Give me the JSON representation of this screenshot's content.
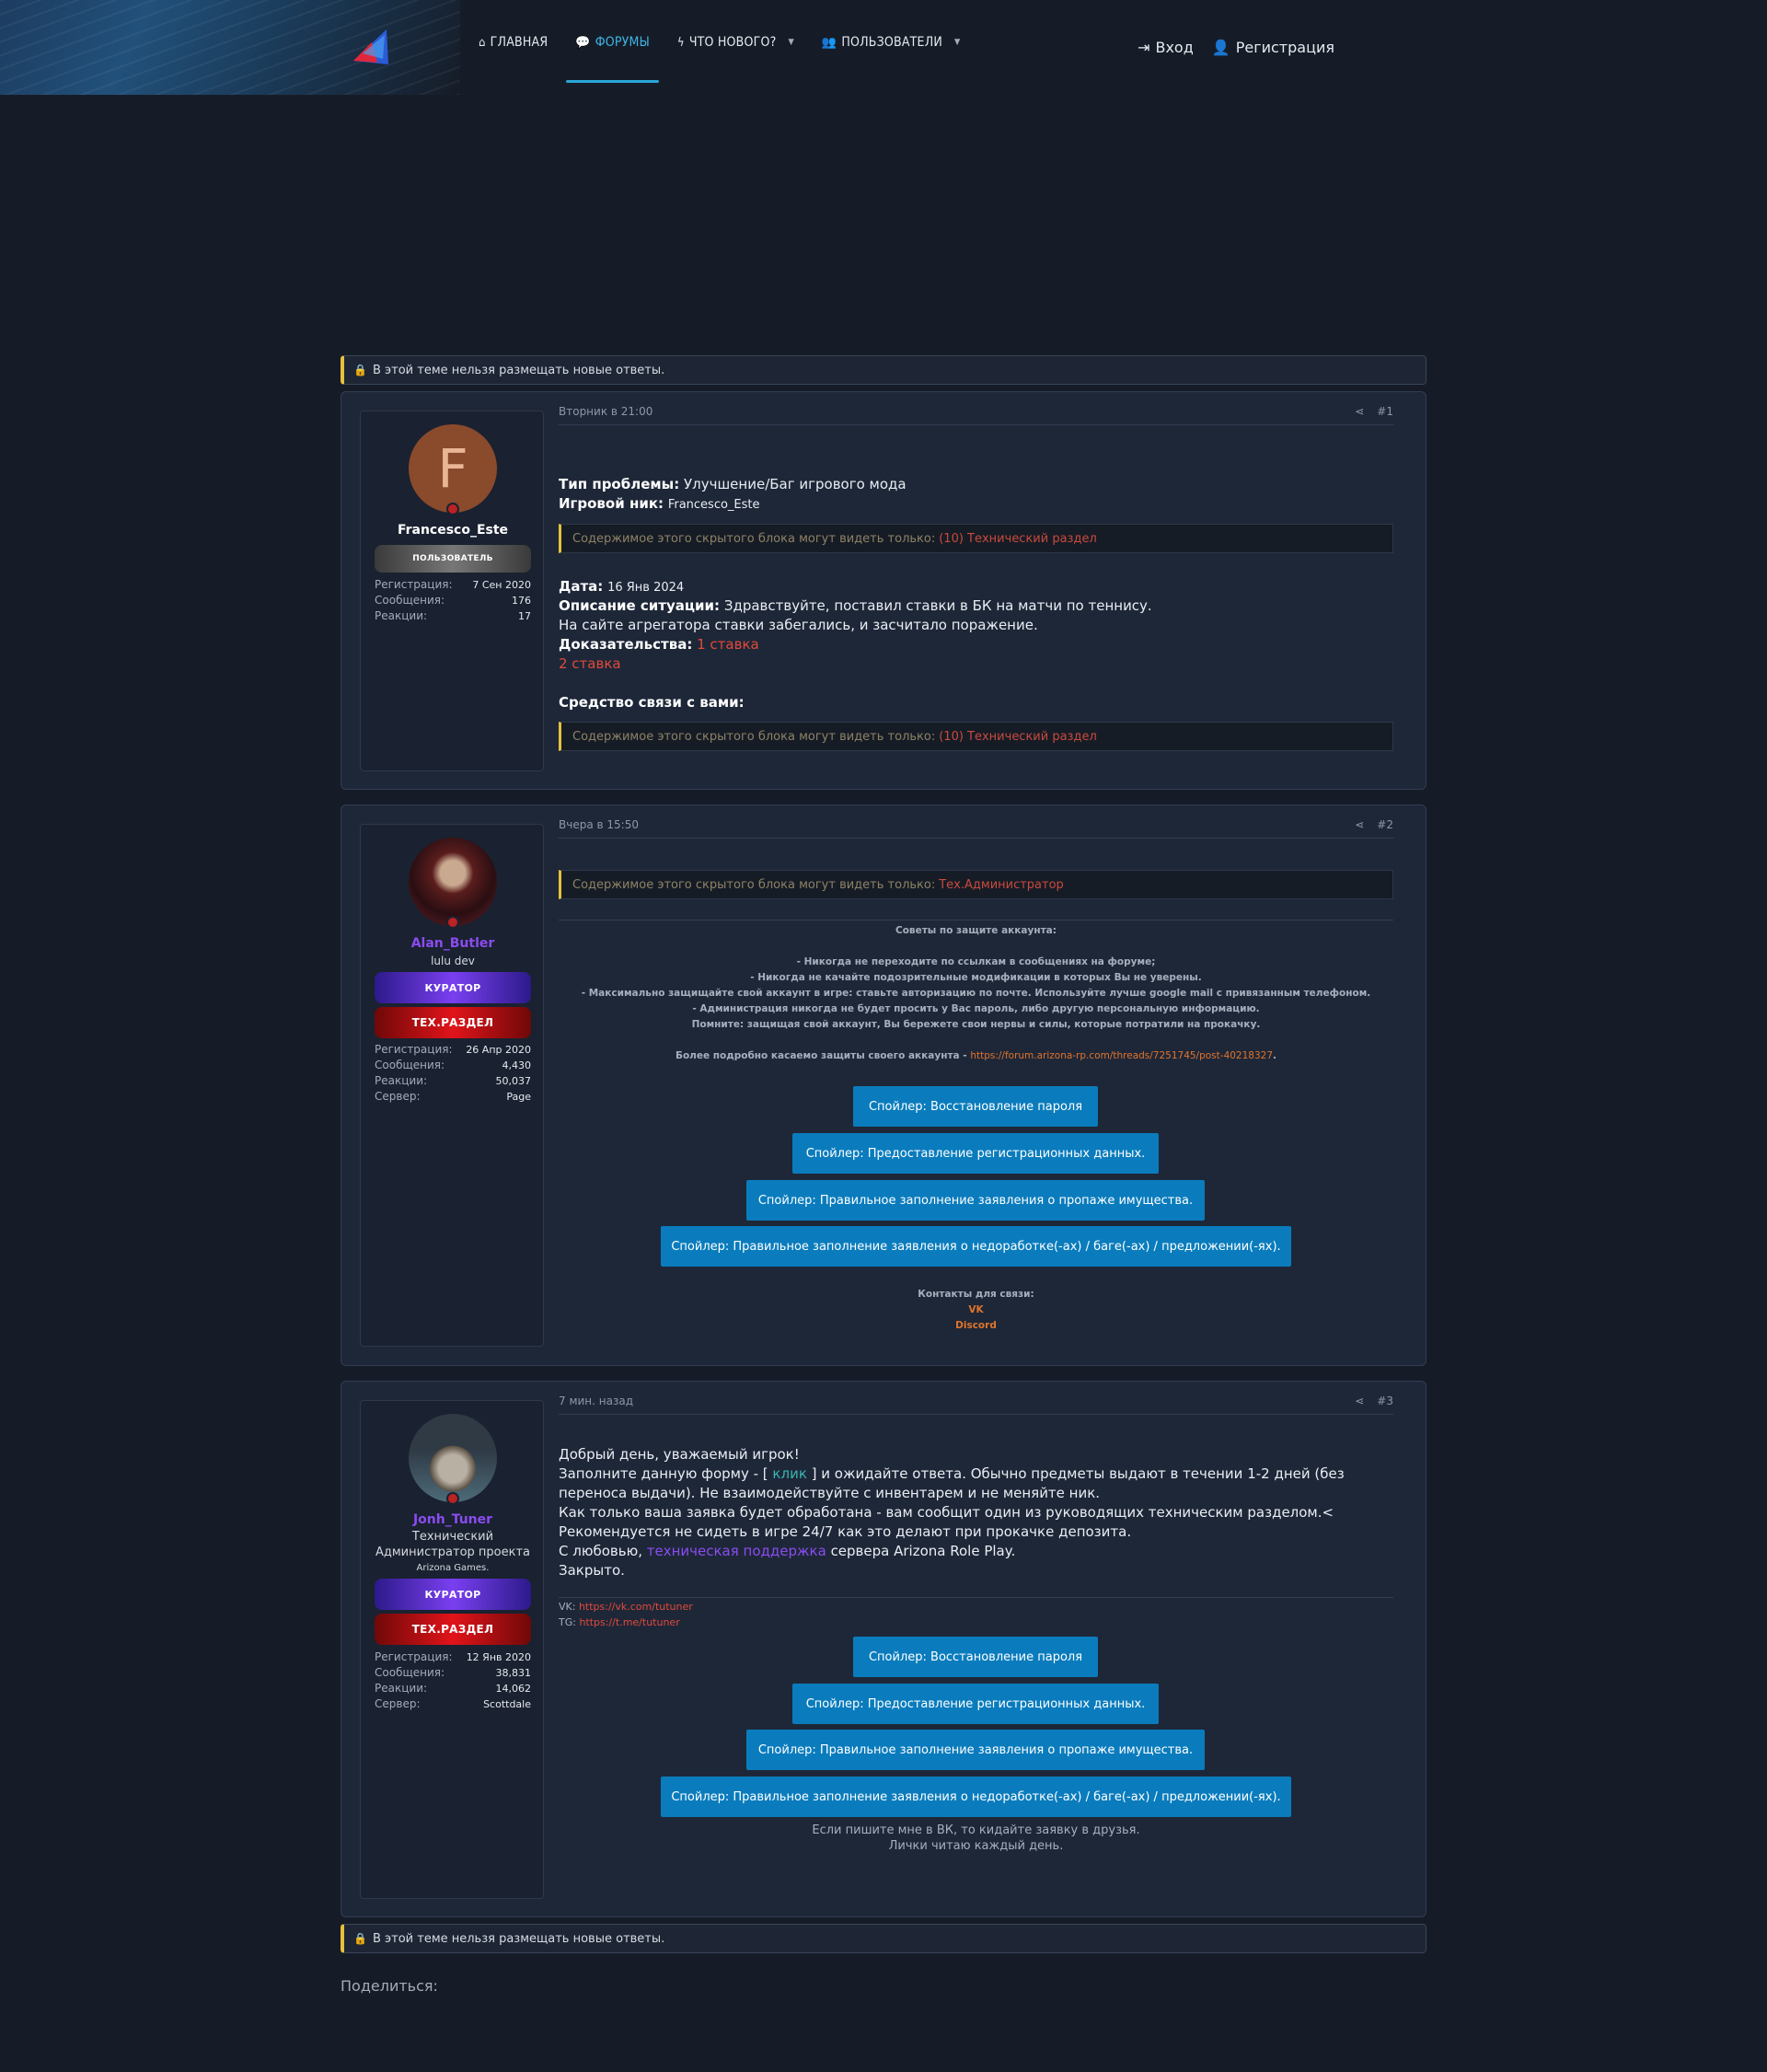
{
  "nav": {
    "home": "ГЛАВНАЯ",
    "forums": "ФОРУМЫ",
    "whats_new": "ЧТО НОВОГО?",
    "users": "ПОЛЬЗОВАТЕЛИ",
    "login": "Вход",
    "register": "Регистрация"
  },
  "notice": {
    "closed": "В этой теме нельзя размещать новые ответы."
  },
  "share_label": "Поделиться:",
  "hidden_prefix": "Содержимое этого скрытого блока могут видеть только:",
  "posts": [
    {
      "date": "Вторник в 21:00",
      "number": "#1",
      "user": {
        "letter": "F",
        "name": "Francesco_Este",
        "banner": "ПОЛЬЗОВАТЕЛЬ",
        "stats": [
          {
            "k": "Регистрация:",
            "v": "7 Сен 2020"
          },
          {
            "k": "Сообщения:",
            "v": "176"
          },
          {
            "k": "Реакции:",
            "v": "17"
          }
        ]
      },
      "problem_label": "Тип проблемы:",
      "problem_value": "Улучшение/Баг игрового мода",
      "nick_label": "Игровой ник:",
      "nick_value": "Francesco_Este",
      "hidden_who": "(10) Технический раздел",
      "date_label": "Дата:",
      "date_value": "16 Янв 2024",
      "desc_label": "Описание ситуации:",
      "desc_value": "Здравствуйте, поставил ставки в БК на матчи по теннису.",
      "desc_line2": "На сайте агрегатора ставки забегались, и засчитало поражение.",
      "proof_label": "Доказательства:",
      "proof_link1": "1 ставка",
      "proof_link2": "2 ставка",
      "contact_label": "Средство связи с вами:"
    },
    {
      "date": "Вчера в 15:50",
      "number": "#2",
      "user": {
        "name": "Alan_Butler",
        "title": "lulu dev",
        "banner1": "КУРАТОР",
        "banner2": "ТЕХ.РАЗДЕЛ",
        "stats": [
          {
            "k": "Регистрация:",
            "v": "26 Апр 2020"
          },
          {
            "k": "Сообщения:",
            "v": "4,430"
          },
          {
            "k": "Реакции:",
            "v": "50,037"
          },
          {
            "k": "Сервер:",
            "v": "Page"
          }
        ]
      },
      "hidden_who": "Тех.Администратор",
      "tips_title": "Советы по защите аккаунта:",
      "tips": [
        "- Никогда не переходите по ссылкам в сообщениях на форуме;",
        "- Никогда не качайте подозрительные модификации в которых Вы не уверены.",
        "- Максимально защищайте свой аккаунт в игре: ставьте авторизацию по почте. Используйте лучше google mail с привязанным телефоном.",
        "- Администрация никогда не будет просить у Вас пароль, либо другую персональную информацию.",
        "Помните: защищая свой аккаунт, Вы бережете свои нервы и силы, которые потратили на прокачку."
      ],
      "more_text": "Более подробно касаемо защиты своего аккаунта -",
      "more_link": "https://forum.arizona-rp.com/threads/7251745/post-40218327",
      "contacts_title": "Контакты для связи:",
      "contact1": "VK",
      "contact2": "Discord"
    },
    {
      "date": "7 мин. назад",
      "number": "#3",
      "user": {
        "name": "Jonh_Tuner",
        "title1": "Технический",
        "title2": "Администратор проекта",
        "title3": "Arizona Games.",
        "banner1": "КУРАТОР",
        "banner2": "ТЕХ.РАЗДЕЛ",
        "stats": [
          {
            "k": "Регистрация:",
            "v": "12 Янв 2020"
          },
          {
            "k": "Сообщения:",
            "v": "38,831"
          },
          {
            "k": "Реакции:",
            "v": "14,062"
          },
          {
            "k": "Сервер:",
            "v": "Scottdale"
          }
        ]
      },
      "l1": "Добрый день, уважаемый игрок!",
      "l2a": "Заполните данную форму - [",
      "l2link": "клик",
      "l2b": "] и ожидайте ответа. Обычно предметы выдают в течении 1-2 дней (без",
      "l3": "переноса выдачи). Не взаимодействуйте с инвентарем и не меняйте ник.",
      "l4": "Как только ваша заявка будет обработана - вам сообщит один из руководящих техническим разделом.<",
      "l5": "Рекомендуется не сидеть в игре 24/7 как это делают при прокачке депозита.",
      "l6a": "С любовью,",
      "l6link": "техническая поддержка",
      "l6b": "сервера Arizona Role Play.",
      "l7": "Закрыто.",
      "vk_label": "VK:",
      "vk_link": "https://vk.com/tutuner",
      "tg_label": "TG:",
      "tg_link": "https://t.me/tutuner",
      "note1": "Если пишите мне в ВК, то кидайте заявку в друзья.",
      "note2": "Лички читаю каждый день."
    }
  ],
  "spoilers": [
    "Спойлер: Восстановление пароля",
    "Спойлер: Предоставление регистрационных данных.",
    "Спойлер: Правильное заполнение заявления о пропаже имущества.",
    "Спойлер: Правильное заполнение заявления о недоработке(-ах) / баге(-ах) / предложении(-ях)."
  ]
}
